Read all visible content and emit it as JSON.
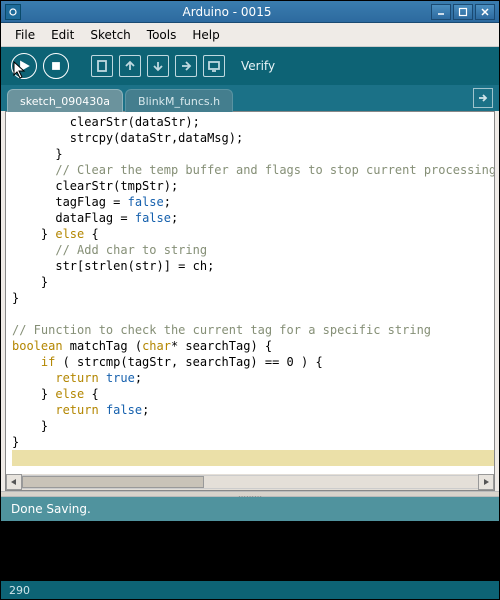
{
  "window": {
    "title": "Arduino - 0015"
  },
  "menu": {
    "file": "File",
    "edit": "Edit",
    "sketch": "Sketch",
    "tools": "Tools",
    "help": "Help"
  },
  "toolbar": {
    "hint": "Verify"
  },
  "tabs": {
    "active": "sketch_090430a",
    "other": "BlinkM_funcs.h"
  },
  "status": {
    "message": "Done Saving."
  },
  "footer": {
    "line": "290"
  },
  "code_lines": [
    {
      "indent": 8,
      "tokens": [
        {
          "t": "clearStr(dataStr);"
        }
      ]
    },
    {
      "indent": 8,
      "tokens": [
        {
          "t": "strcpy(dataStr,dataMsg);"
        }
      ]
    },
    {
      "indent": 6,
      "tokens": [
        {
          "t": "}"
        }
      ]
    },
    {
      "indent": 6,
      "tokens": [
        {
          "t": "// Clear the temp buffer and flags to stop current processing ",
          "c": "cmt"
        }
      ]
    },
    {
      "indent": 6,
      "tokens": [
        {
          "t": "clearStr(tmpStr);"
        }
      ]
    },
    {
      "indent": 6,
      "tokens": [
        {
          "t": "tagFlag = "
        },
        {
          "t": "false",
          "c": "kw-bool"
        },
        {
          "t": ";"
        }
      ]
    },
    {
      "indent": 6,
      "tokens": [
        {
          "t": "dataFlag = "
        },
        {
          "t": "false",
          "c": "kw-bool"
        },
        {
          "t": ";"
        }
      ]
    },
    {
      "indent": 4,
      "tokens": [
        {
          "t": "} "
        },
        {
          "t": "else",
          "c": "kw-ctrl"
        },
        {
          "t": " {"
        }
      ]
    },
    {
      "indent": 6,
      "tokens": [
        {
          "t": "// Add char to string",
          "c": "cmt"
        }
      ]
    },
    {
      "indent": 6,
      "tokens": [
        {
          "t": "str[strlen(str)] = ch;"
        }
      ]
    },
    {
      "indent": 4,
      "tokens": [
        {
          "t": "}"
        }
      ]
    },
    {
      "indent": 0,
      "tokens": [
        {
          "t": "}"
        }
      ]
    },
    {
      "indent": 0,
      "tokens": [
        {
          "t": ""
        }
      ]
    },
    {
      "indent": 0,
      "tokens": [
        {
          "t": "// Function to check the current tag for a specific string",
          "c": "cmt"
        }
      ]
    },
    {
      "indent": 0,
      "tokens": [
        {
          "t": "boolean",
          "c": "kw-type"
        },
        {
          "t": " matchTag ("
        },
        {
          "t": "char",
          "c": "kw-type"
        },
        {
          "t": "* searchTag) {"
        }
      ]
    },
    {
      "indent": 4,
      "tokens": [
        {
          "t": "if",
          "c": "kw-ctrl"
        },
        {
          "t": " ( strcmp(tagStr, searchTag) == 0 ) {"
        }
      ]
    },
    {
      "indent": 6,
      "tokens": [
        {
          "t": "return",
          "c": "kw-ctrl"
        },
        {
          "t": " "
        },
        {
          "t": "true",
          "c": "kw-bool"
        },
        {
          "t": ";"
        }
      ]
    },
    {
      "indent": 4,
      "tokens": [
        {
          "t": "} "
        },
        {
          "t": "else",
          "c": "kw-ctrl"
        },
        {
          "t": " {"
        }
      ]
    },
    {
      "indent": 6,
      "tokens": [
        {
          "t": "return",
          "c": "kw-ctrl"
        },
        {
          "t": " "
        },
        {
          "t": "false",
          "c": "kw-bool"
        },
        {
          "t": ";"
        }
      ]
    },
    {
      "indent": 4,
      "tokens": [
        {
          "t": "}"
        }
      ]
    },
    {
      "indent": 0,
      "tokens": [
        {
          "t": "}"
        }
      ]
    },
    {
      "indent": 0,
      "hl": true,
      "tokens": [
        {
          "t": ""
        }
      ]
    },
    {
      "indent": 0,
      "tokens": [
        {
          "t": ""
        }
      ]
    }
  ]
}
